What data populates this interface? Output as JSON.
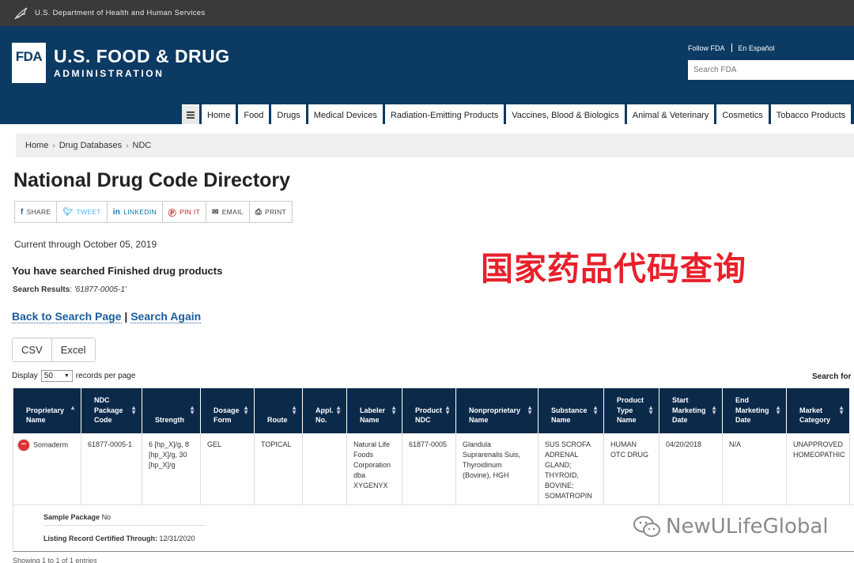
{
  "hhs_bar": {
    "text": "U.S. Department of Health and Human Services"
  },
  "header": {
    "logo_text": "FDA",
    "title": "U.S. FOOD & DRUG",
    "subtitle": "ADMINISTRATION",
    "follow_label": "Follow FDA",
    "espanol_label": "En Español",
    "search_placeholder": "Search FDA"
  },
  "nav": {
    "menu_icon": "hamburger-icon",
    "items": [
      "Home",
      "Food",
      "Drugs",
      "Medical Devices",
      "Radiation-Emitting Products",
      "Vaccines, Blood & Biologics",
      "Animal & Veterinary",
      "Cosmetics",
      "Tobacco Products"
    ]
  },
  "breadcrumb": {
    "items": [
      "Home",
      "Drug Databases",
      "NDC"
    ]
  },
  "page_title": "National Drug Code Directory",
  "share": {
    "share": "SHARE",
    "tweet": "TWEET",
    "linkedin": "LINKEDIN",
    "pinit": "PIN IT",
    "email": "EMAIL",
    "print": "PRINT"
  },
  "current_through": "Current through October 05, 2019",
  "overlay_title": "国家药品代码查询",
  "searched_heading": "You have searched Finished drug products",
  "search_results": {
    "label": "Search Results",
    "value": "'61877-0005-1'"
  },
  "links": {
    "back": "Back to Search Page",
    "separator": "|",
    "again": "Search Again"
  },
  "export": {
    "csv": "CSV",
    "excel": "Excel"
  },
  "display": {
    "prefix": "Display",
    "value": "50",
    "suffix": "records per page"
  },
  "search_for_label": "Search for",
  "table": {
    "headers": [
      "Proprietary Name",
      "NDC Package Code",
      "Strength",
      "Dosage Form",
      "Route",
      "Appl. No.",
      "Labeler Name",
      "Product NDC",
      "Nonproprietary Name",
      "Substance Name",
      "Product Type Name",
      "Start Marketing Date",
      "End Marketing Date",
      "Market Category"
    ],
    "row": {
      "proprietary_name": "Somaderm",
      "ndc_package_code": "61877-0005-1",
      "strength": "6 [hp_X]/g, 8 [hp_X]/g, 30 [hp_X]/g",
      "dosage_form": "GEL",
      "route": "TOPICAL",
      "appl_no": "",
      "labeler_name": "Natural Life Foods Corporation dba XYGENYX",
      "product_ndc": "61877-0005",
      "nonproprietary_name": "Glandula Suprarenalis Suis, Thyroidinum (Bovine), HGH",
      "substance_name": "SUS SCROFA ADRENAL GLAND; THYROID, BOVINE; SOMATROPIN",
      "product_type": "HUMAN OTC DRUG",
      "start_date": "04/20/2018",
      "end_date": "N/A",
      "market_category": "UNAPPROVED HOMEOPATHIC"
    },
    "detail": {
      "sample_label": "Sample Package",
      "sample_value": "No",
      "certified_label": "Listing Record Certified Through:",
      "certified_value": "12/31/2020"
    }
  },
  "showing": "Showing 1 to 1 of 1 entries",
  "watermark": "NewULifeGlobal"
}
